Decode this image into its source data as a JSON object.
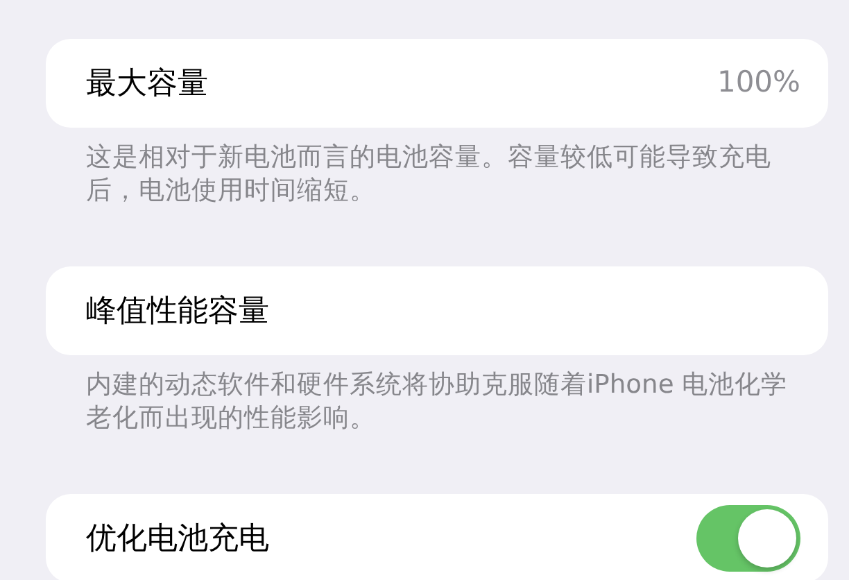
{
  "sections": [
    {
      "title": "最大容量",
      "value": "100%",
      "footer": "这是相对于新电池而言的电池容量。容量较低可能导致充电后，电池使用时间缩短。"
    },
    {
      "title": "峰值性能容量",
      "footer": "内建的动态软件和硬件系统将协助克服随着iPhone 电池化学老化而出现的性能影响。"
    },
    {
      "title": "优化电池充电",
      "toggle": {
        "on": true
      }
    }
  ]
}
